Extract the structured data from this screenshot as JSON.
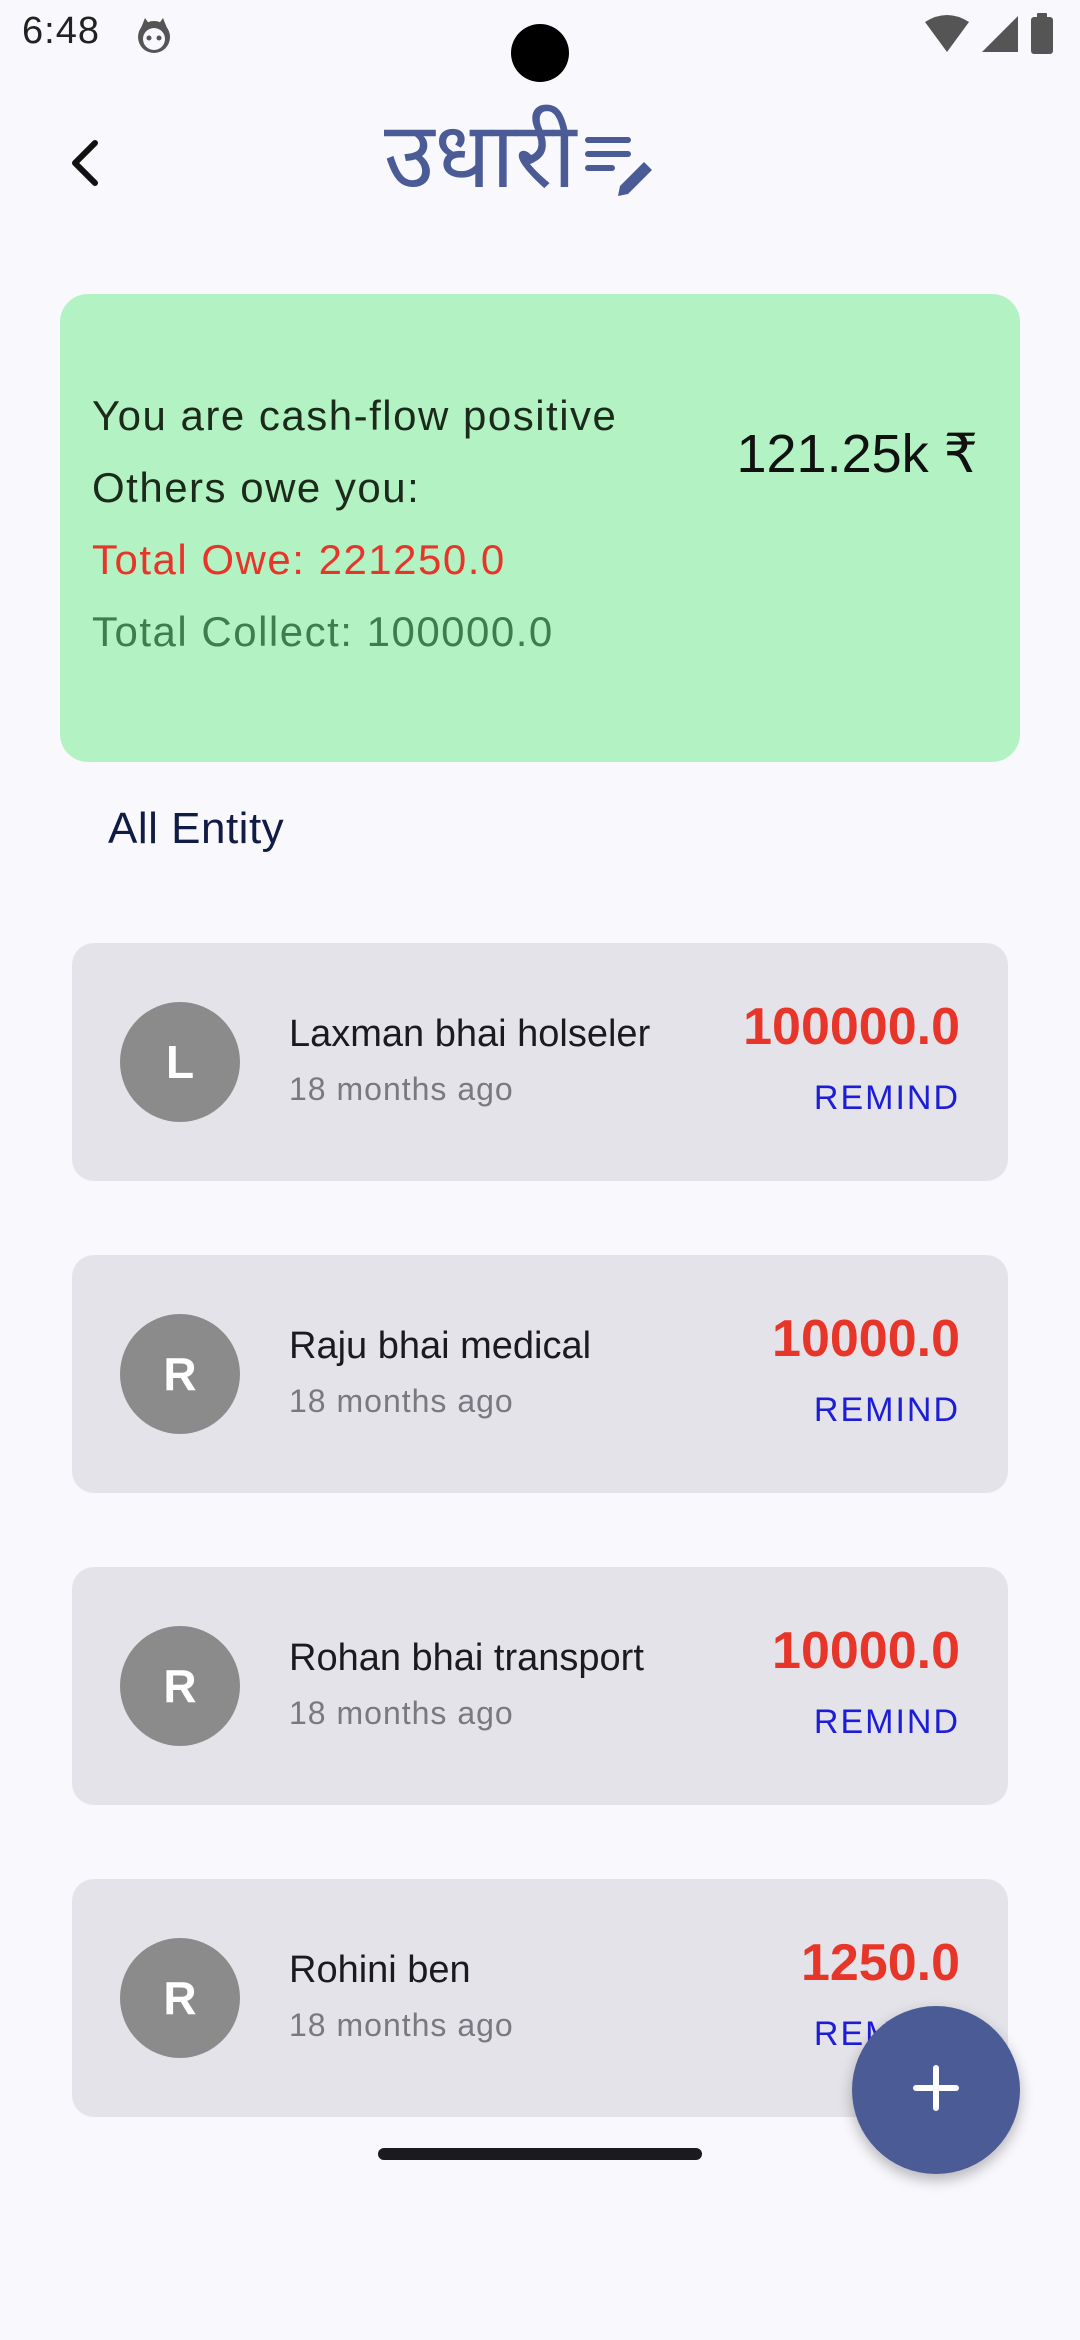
{
  "status_bar": {
    "time": "6:48",
    "icons": [
      "app-notification-icon",
      "wifi-icon",
      "cellular-signal-icon",
      "battery-icon"
    ]
  },
  "app_bar": {
    "back_icon": "chevron-left-icon",
    "logo_text": "उधारी",
    "logo_icon": "edit-list-icon",
    "logo_color": "#4a5b96"
  },
  "summary": {
    "status_line": "You are cash-flow positive",
    "relation_line": "Others owe you:",
    "total_owe": "Total Owe: 221250.0",
    "total_collect": "Total Collect: 100000.0",
    "net_amount": "121.25k ₹",
    "background_color": "#b3f2c2",
    "owe_color": "#e8352a",
    "collect_color": "#3e7d4c"
  },
  "section": {
    "title": "All Entity"
  },
  "entities": [
    {
      "initial": "L",
      "name": "Laxman bhai holseler",
      "time": "18 months ago",
      "amount": "100000.0",
      "action": "REMIND"
    },
    {
      "initial": "R",
      "name": "Raju bhai medical",
      "time": "18 months ago",
      "amount": "10000.0",
      "action": "REMIND"
    },
    {
      "initial": "R",
      "name": "Rohan bhai transport",
      "time": "18 months ago",
      "amount": "10000.0",
      "action": "REMIND"
    },
    {
      "initial": "R",
      "name": "Rohini ben",
      "time": "18 months ago",
      "amount": "1250.0",
      "action": "REMIND"
    }
  ],
  "colors": {
    "amount": "#e8352a",
    "remind": "#1d1dd6",
    "fab": "#4a5b96",
    "card": "#e4e3e9",
    "avatar": "#8b8b8b"
  },
  "fab": {
    "icon": "plus-icon"
  }
}
